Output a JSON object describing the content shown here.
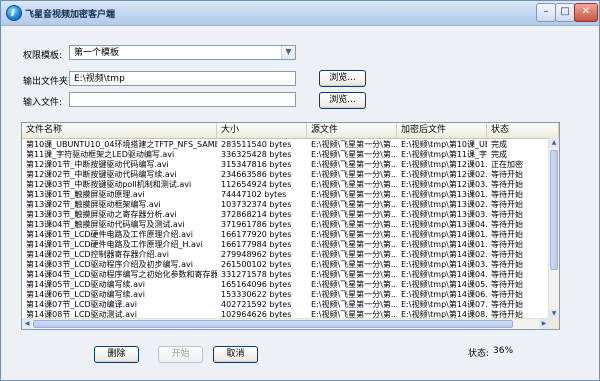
{
  "window": {
    "title": "飞星音视频加密客户端"
  },
  "form": {
    "template_label": "权限模板:",
    "template_value": "第一个模板",
    "output_label": "输出文件夹:",
    "output_value": "E:\\视频\\tmp",
    "input_label": "输入文件:",
    "input_value": "",
    "browse_label": "浏览..."
  },
  "table": {
    "headers": [
      "文件名称",
      "大小",
      "源文件",
      "加密后文件",
      "状态"
    ],
    "rows": [
      {
        "name": "第10课_UBUNTU10_04环境搭建之TFTP_NFS_SAMBA.avi",
        "size": "283511540 bytes",
        "src": "E:\\视频\\飞星第一分\\第...",
        "dst": "E:\\视频\\tmp\\第10课_UB...",
        "status": "完成"
      },
      {
        "name": "第11课_字符驱动框架之LED驱动编写.avi",
        "size": "336325428 bytes",
        "src": "E:\\视频\\飞星第一分\\第...",
        "dst": "E:\\视频\\tmp\\第11课_字...",
        "status": "完成"
      },
      {
        "name": "第12课01节_中断按键驱动代码编写.avi",
        "size": "315347816 bytes",
        "src": "E:\\视频\\飞星第一分\\第...",
        "dst": "E:\\视频\\tmp\\第12课01...",
        "status": "正在加密"
      },
      {
        "name": "第12课02节_中断按键驱动代码编写续.avi",
        "size": "234663586 bytes",
        "src": "E:\\视频\\飞星第一分\\第...",
        "dst": "E:\\视频\\tmp\\第12课02...",
        "status": "等待开始"
      },
      {
        "name": "第12课03节_中断按键驱动poll机制和测试.avi",
        "size": "112654924 bytes",
        "src": "E:\\视频\\飞星第一分\\第...",
        "dst": "E:\\视频\\tmp\\第12课03...",
        "status": "等待开始"
      },
      {
        "name": "第13课01节_触摸屏驱动原理.avi",
        "size": "74447102 bytes",
        "src": "E:\\视频\\飞星第一分\\第...",
        "dst": "E:\\视频\\tmp\\第13课01...",
        "status": "等待开始"
      },
      {
        "name": "第13课02节_触摸屏驱动框架编写.avi",
        "size": "103732374 bytes",
        "src": "E:\\视频\\飞星第一分\\第...",
        "dst": "E:\\视频\\tmp\\第13课02...",
        "status": "等待开始"
      },
      {
        "name": "第13课03节_触摸屏驱动之寄存器分析.avi",
        "size": "372868214 bytes",
        "src": "E:\\视频\\飞星第一分\\第...",
        "dst": "E:\\视频\\tmp\\第13课03...",
        "status": "等待开始"
      },
      {
        "name": "第13课04节_触摸屏驱动代码编写及测试.avi",
        "size": "371961786 bytes",
        "src": "E:\\视频\\飞星第一分\\第...",
        "dst": "E:\\视频\\tmp\\第13课04...",
        "status": "等待开始"
      },
      {
        "name": "第14课01节_LCD硬件电路及工作原理介绍.avi",
        "size": "166177920 bytes",
        "src": "E:\\视频\\飞星第一分\\第...",
        "dst": "E:\\视频\\tmp\\第14课01...",
        "status": "等待开始"
      },
      {
        "name": "第14课01节_LCD硬件电路及工作原理介绍_H.avi",
        "size": "166177984 bytes",
        "src": "E:\\视频\\飞星第一分\\第...",
        "dst": "E:\\视频\\tmp\\第14课01...",
        "status": "等待开始"
      },
      {
        "name": "第14课02节_LCD控制器寄存器介绍.avi",
        "size": "279948962 bytes",
        "src": "E:\\视频\\飞星第一分\\第...",
        "dst": "E:\\视频\\tmp\\第14课02...",
        "status": "等待开始"
      },
      {
        "name": "第14课03节_LCD驱动程序介绍及初步编写.avi",
        "size": "261500102 bytes",
        "src": "E:\\视频\\飞星第一分\\第...",
        "dst": "E:\\视频\\tmp\\第14课03...",
        "status": "等待开始"
      },
      {
        "name": "第14课04节_LCD驱动程序编写之初始化参数和寄存器.avi",
        "size": "331271578 bytes",
        "src": "E:\\视频\\飞星第一分\\第...",
        "dst": "E:\\视频\\tmp\\第14课04...",
        "status": "等待开始"
      },
      {
        "name": "第14课05节_LCD驱动编写续.avi",
        "size": "165164096 bytes",
        "src": "E:\\视频\\飞星第一分\\第...",
        "dst": "E:\\视频\\tmp\\第14课05...",
        "status": "等待开始"
      },
      {
        "name": "第14课06节_LCD驱动编写续.avi",
        "size": "153330622 bytes",
        "src": "E:\\视频\\飞星第一分\\第...",
        "dst": "E:\\视频\\tmp\\第14课06...",
        "status": "等待开始"
      },
      {
        "name": "第14课07节_LCD驱动编译.avi",
        "size": "402721592 bytes",
        "src": "E:\\视频\\飞星第一分\\第...",
        "dst": "E:\\视频\\tmp\\第14课07...",
        "status": "等待开始"
      },
      {
        "name": "第14课08节_LCD驱动测试.avi",
        "size": "102964626 bytes",
        "src": "E:\\视频\\飞星第一分\\第...",
        "dst": "E:\\视频\\tmp\\第14课08...",
        "status": "等待开始"
      }
    ]
  },
  "footer": {
    "delete_label": "删除",
    "start_label": "开始",
    "cancel_label": "取消",
    "status_label": "状态:",
    "status_value": "36%"
  }
}
